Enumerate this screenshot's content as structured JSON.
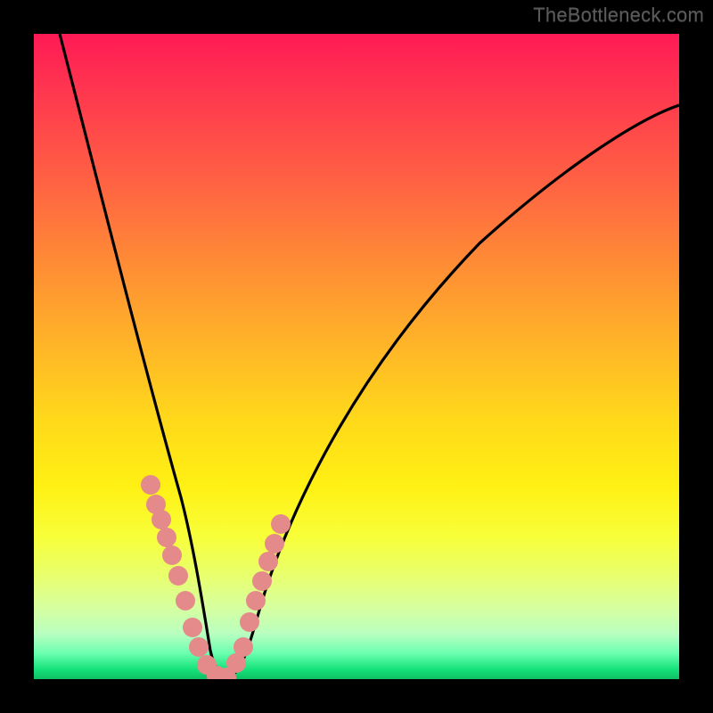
{
  "watermark": "TheBottleneck.com",
  "chart_data": {
    "type": "line",
    "title": "",
    "xlabel": "",
    "ylabel": "",
    "xlim": [
      0,
      100
    ],
    "ylim": [
      0,
      100
    ],
    "grid": false,
    "gradient_colors_top_to_bottom": [
      "#ff1a55",
      "#ff8a36",
      "#ffd91a",
      "#f7ff3a",
      "#14e27a"
    ],
    "series": [
      {
        "name": "bottleneck-curve",
        "stroke": "#000000",
        "x": [
          4,
          6,
          8,
          10,
          12,
          14,
          16,
          18,
          20,
          22,
          24,
          25,
          26,
          27,
          28,
          29,
          30,
          32,
          34,
          36,
          40,
          45,
          50,
          55,
          60,
          65,
          70,
          75,
          80,
          85,
          90,
          95,
          100
        ],
        "y": [
          100,
          92,
          84,
          76,
          68,
          60,
          52,
          44,
          36,
          26,
          14,
          8,
          3,
          1,
          0,
          0,
          0,
          4,
          10,
          16,
          27,
          38,
          47,
          54,
          59,
          64,
          68,
          71,
          74,
          76,
          78,
          80,
          81
        ]
      },
      {
        "name": "dot-markers",
        "type": "scatter",
        "color": "#e58a8a",
        "x": [
          17.5,
          18.5,
          19.2,
          20.0,
          20.8,
          21.8,
          23.0,
          24.2,
          25.2,
          26.5,
          28.0,
          29.5,
          31.0,
          32.0,
          33.0,
          34.0,
          34.8,
          35.8,
          36.8,
          37.8
        ],
        "y": [
          30,
          27,
          25,
          22,
          19,
          16,
          12,
          8,
          5,
          2,
          0,
          0,
          2,
          5,
          9,
          12,
          15,
          18,
          21,
          24
        ]
      }
    ]
  }
}
